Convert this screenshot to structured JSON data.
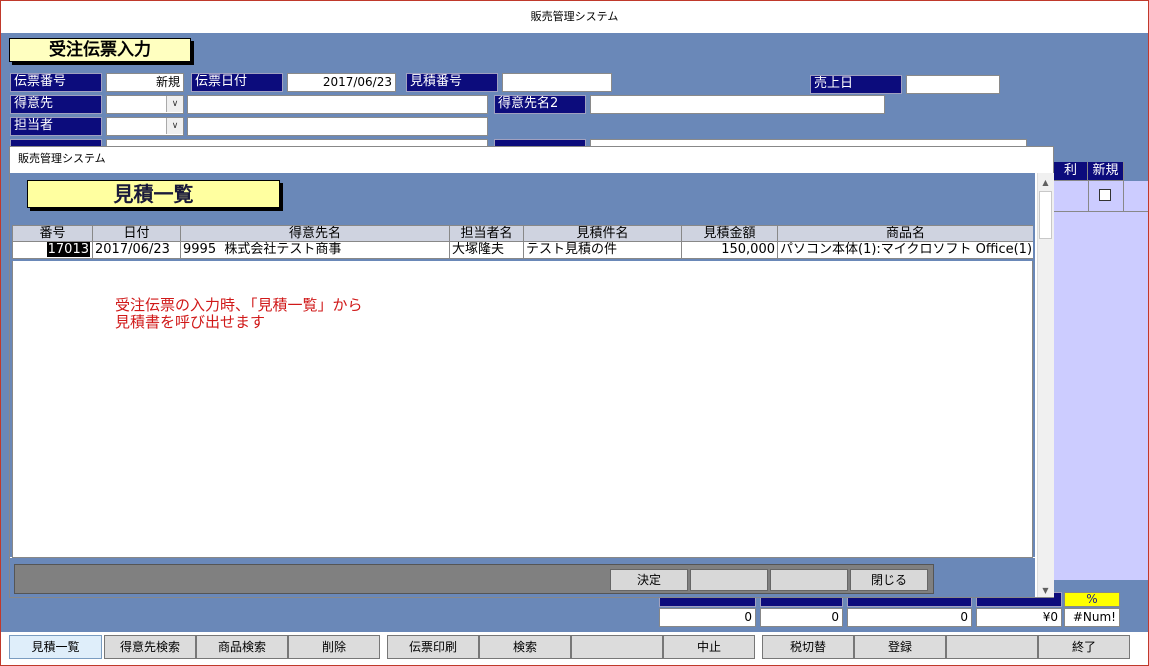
{
  "window": {
    "title": "販売管理システム"
  },
  "form": {
    "title": "受注伝票入力",
    "fields": {
      "slip_no_label": "伝票番号",
      "slip_no_value": "新規",
      "slip_date_label": "伝票日付",
      "slip_date_value": "2017/06/23",
      "estimate_no_label": "見積番号",
      "estimate_no_value": "",
      "sales_date_label": "売上日",
      "sales_date_value": "",
      "customer_label": "得意先",
      "customer_code": "",
      "customer_name": "",
      "customer_name2_label": "得意先名2",
      "customer_name2_value": "",
      "staff_label": "担当者",
      "staff_code": "",
      "staff_name": ""
    },
    "grid_headers": {
      "profit": "利",
      "new": "新規"
    },
    "totals": {
      "percent_label": "%",
      "v1": "0",
      "v2": "0",
      "v3": "0",
      "v4": "¥0",
      "v5": "#Num!"
    }
  },
  "dialog": {
    "title": "販売管理システム",
    "form_title": "見積一覧",
    "columns": [
      "番号",
      "日付",
      "得意先名",
      "担当者名",
      "見積件名",
      "見積金額",
      "商品名"
    ],
    "rows": [
      {
        "no": "17013",
        "date": "2017/06/23",
        "customer_code": "9995",
        "customer_name": "株式会社テスト商事",
        "staff": "大塚隆夫",
        "subject": "テスト見積の件",
        "amount": "150,000",
        "items": "パソコン本体(1):マイクロソフト Office(1):"
      }
    ],
    "note": "受注伝票の入力時、「見積一覧」から\n見積書を呼び出せます",
    "buttons": {
      "decide": "決定",
      "blank1": "",
      "blank2": "",
      "close": "閉じる"
    }
  },
  "toolbar": {
    "buttons": [
      "見積一覧",
      "得意先検索",
      "商品検索",
      "削除",
      "伝票印刷",
      "検索",
      "",
      "中止",
      "税切替",
      "登録",
      "",
      "終了"
    ]
  },
  "colors": {
    "form_bg": "#6a88b8",
    "label_bg": "#0c0c7c",
    "title_bg": "#ffffc0",
    "note": "#d01818"
  }
}
